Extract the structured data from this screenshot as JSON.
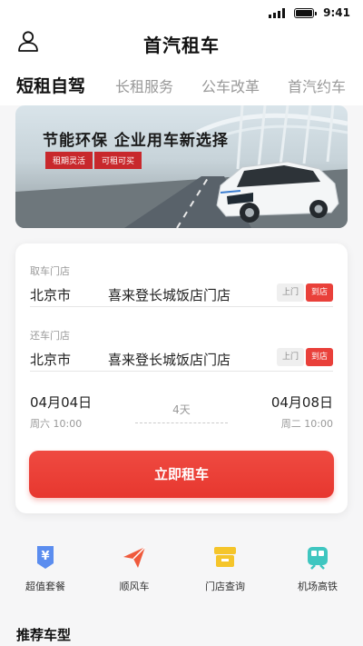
{
  "status_bar": {
    "time": "9:41"
  },
  "header": {
    "title": "首汽租车",
    "profile_icon": "user-outline-icon"
  },
  "tabs": [
    {
      "label": "短租自驾",
      "active": true
    },
    {
      "label": "长租服务",
      "active": false
    },
    {
      "label": "公车改革",
      "active": false
    },
    {
      "label": "首汽约车",
      "active": false
    }
  ],
  "banner": {
    "headline": "节能环保  企业用车新选择",
    "tags": [
      "租期灵活",
      "可租可买"
    ]
  },
  "booking": {
    "pickup": {
      "label": "取车门店",
      "city": "北京市",
      "store": "喜来登长城饭店门店",
      "option_off": "上门",
      "option_on": "到店"
    },
    "return": {
      "label": "还车门店",
      "city": "北京市",
      "store": "喜来登长城饭店门店",
      "option_off": "上门",
      "option_on": "到店"
    },
    "start": {
      "date": "04月04日",
      "weekday_time": "周六 10:00"
    },
    "end": {
      "date": "04月08日",
      "weekday_time": "周二 10:00"
    },
    "duration": "4天",
    "submit_label": "立即租车"
  },
  "quick_links": [
    {
      "label": "超值套餐",
      "icon": "yen-tag-icon",
      "color": "#5b8def"
    },
    {
      "label": "顺风车",
      "icon": "paper-plane-icon",
      "color": "#ef5a3c"
    },
    {
      "label": "门店查询",
      "icon": "store-icon",
      "color": "#f5c52a"
    },
    {
      "label": "机场高铁",
      "icon": "train-icon",
      "color": "#3fc6c0"
    }
  ],
  "section": {
    "title": "推荐车型"
  },
  "theme": {
    "accent": "#e9403a"
  }
}
